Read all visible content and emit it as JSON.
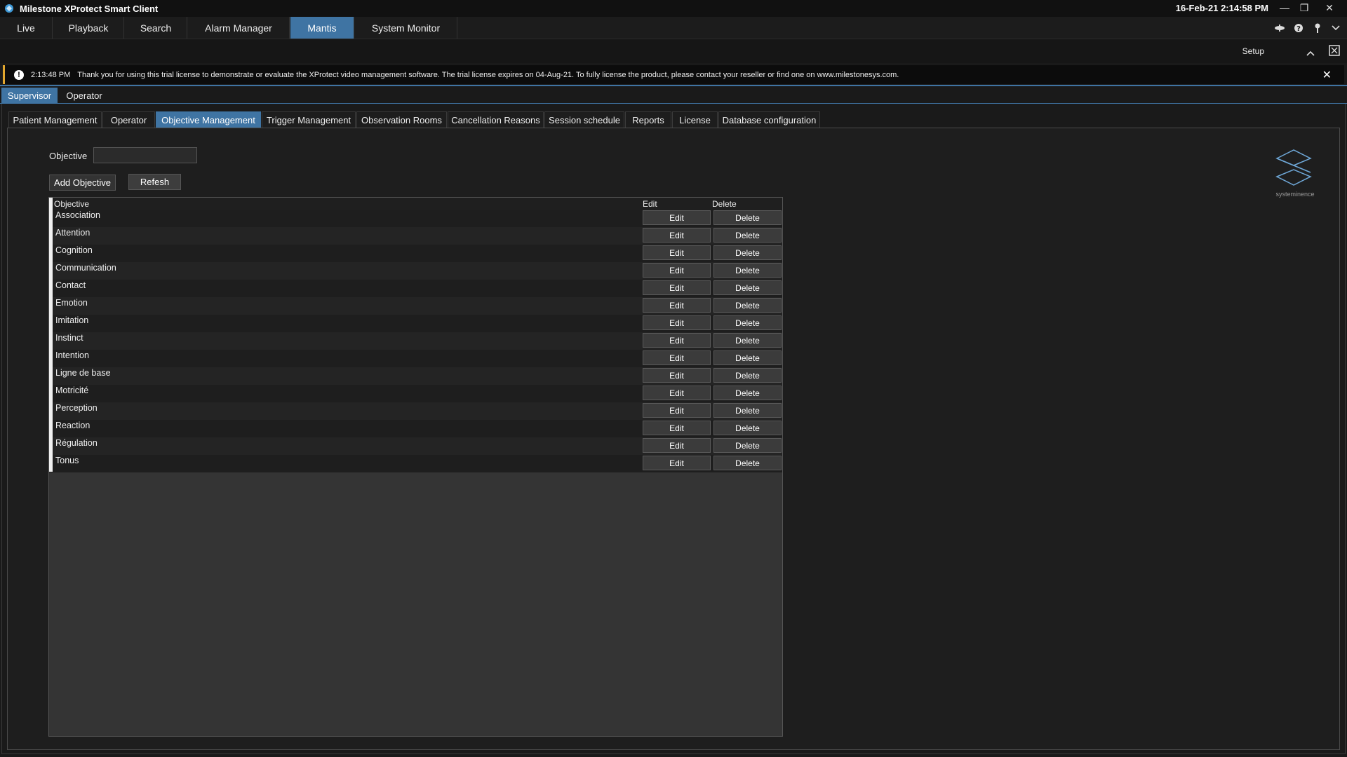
{
  "window": {
    "title": "Milestone XProtect Smart Client",
    "clock": "16-Feb-21 2:14:58 PM",
    "controls": [
      "minimize-icon",
      "restore-icon",
      "close-icon"
    ]
  },
  "main_nav": {
    "tabs": [
      {
        "label": "Live",
        "active": false
      },
      {
        "label": "Playback",
        "active": false
      },
      {
        "label": "Search",
        "active": false
      },
      {
        "label": "Alarm Manager",
        "active": false
      },
      {
        "label": "Mantis",
        "active": true
      },
      {
        "label": "System Monitor",
        "active": false
      }
    ],
    "icons": [
      "status-icon",
      "help-icon",
      "pin-icon",
      "chevron-down-icon"
    ]
  },
  "setup": {
    "label": "Setup"
  },
  "banner": {
    "time": "2:13:48 PM",
    "message": "Thank you for using this trial license to demonstrate or evaluate the XProtect video management software. The trial license expires on 04-Aug-21. To fully license the product, please contact your reseller or find one on www.milestonesys.com.",
    "accent": "#e2a72e"
  },
  "role_tabs": [
    {
      "label": "Supervisor",
      "active": true
    },
    {
      "label": "Operator",
      "active": false
    }
  ],
  "sub_tabs": [
    {
      "label": "Patient Management",
      "active": false
    },
    {
      "label": "Operator",
      "active": false
    },
    {
      "label": "Objective Management",
      "active": true
    },
    {
      "label": "Trigger Management",
      "active": false
    },
    {
      "label": "Observation Rooms",
      "active": false
    },
    {
      "label": "Cancellation Reasons",
      "active": false
    },
    {
      "label": "Session schedule",
      "active": false
    },
    {
      "label": "Reports",
      "active": false
    },
    {
      "label": "License",
      "active": false
    },
    {
      "label": "Database configuration",
      "active": false
    }
  ],
  "form": {
    "objective_label": "Objective",
    "objective_value": "",
    "add_button": "Add Objective",
    "refresh_button": "Refesh"
  },
  "grid": {
    "headers": {
      "objective": "Objective",
      "edit": "Edit",
      "delete": "Delete"
    },
    "edit_label": "Edit",
    "delete_label": "Delete",
    "rows": [
      "Association",
      "Attention",
      "Cognition",
      "Communication",
      "Contact",
      "Emotion",
      "Imitation",
      "Instinct",
      "Intention",
      "Ligne de base",
      "Motricité",
      "Perception",
      "Reaction",
      "Régulation",
      "Tonus"
    ]
  },
  "logo": {
    "text": "systeminence"
  },
  "colors": {
    "accent_blue": "#3f74a3",
    "background": "#1a1a1a",
    "banner_accent": "#e2a72e"
  }
}
